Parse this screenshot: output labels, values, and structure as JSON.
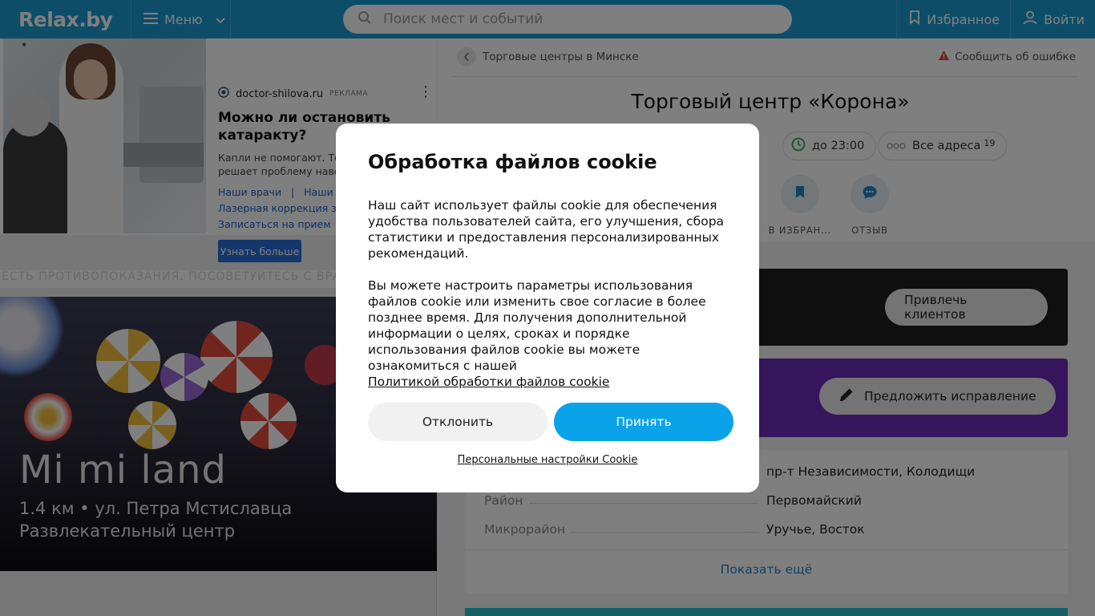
{
  "header": {
    "logo": "Relax.by",
    "menu_label": "Меню",
    "search_placeholder": "Поиск мест и событий",
    "favorites_label": "Избранное",
    "login_label": "Войти"
  },
  "ad": {
    "source": "doctor-shilova.ru",
    "tag": "РЕКЛАМА",
    "title": "Можно ли остановить катаракту?",
    "text": "Капли не помогают. Только хирургия решает проблему навсегда.",
    "link1": "Наши врачи",
    "link_sep": "|",
    "link2": "Наши цены",
    "link3": "Лазерная коррекция зрения",
    "link4": "Записаться на прием",
    "button": "Узнать больше",
    "warning": "ЕСТЬ ПРОТИВОПОКАЗАНИЯ. ПОСОВЕТУЙТЕСЬ С ВРАЧОМ"
  },
  "promo": {
    "title": "Mi mi land",
    "subtitle": "1.4 км • ул. Петра Мстиславца",
    "category": "Развлекательный центр"
  },
  "place": {
    "breadcrumb": "Торговые центры в Минске",
    "report": "Сообщить об ошибке",
    "title": "Торговый центр «Корона»",
    "hours": "до 23:00",
    "all_addresses": "Все адреса",
    "addresses_count": "19",
    "action_favorite": "В ИЗБРАН...",
    "action_review": "ОТЗЫВ",
    "attract_button": "Привлечь клиентов",
    "suggest_button": "Предложить исправление",
    "rows": [
      {
        "key": "",
        "value": "пр-т Независимости, Колодищи"
      },
      {
        "key": "Район",
        "value": "Первомайский"
      },
      {
        "key": "Микрорайон",
        "value": "Уручье, Восток"
      }
    ],
    "show_more": "Показать ещё"
  },
  "cookie": {
    "title": "Обработка файлов cookie",
    "p1": "Наш сайт использует файлы cookie для обеспечения удобства пользователей сайта, его улучшения, сбора статистики и предоставления персонализированных рекомендаций.",
    "p2": "Вы можете настроить параметры использования файлов cookie или изменить свое согласие в более позднее время. Для получения дополнительной информации о целях, сроках и порядке использования файлов cookie вы можете ознакомиться с нашей",
    "policy_link": "Политикой обработки файлов cookie",
    "decline": "Отклонить",
    "accept": "Принять",
    "personal": "Персональные настройки Cookie"
  },
  "colors": {
    "header_bg": "#1b9bd1",
    "accept_bg": "#0aa3ea",
    "purple_card": "#6a2bb8",
    "link": "#1e84c6"
  }
}
